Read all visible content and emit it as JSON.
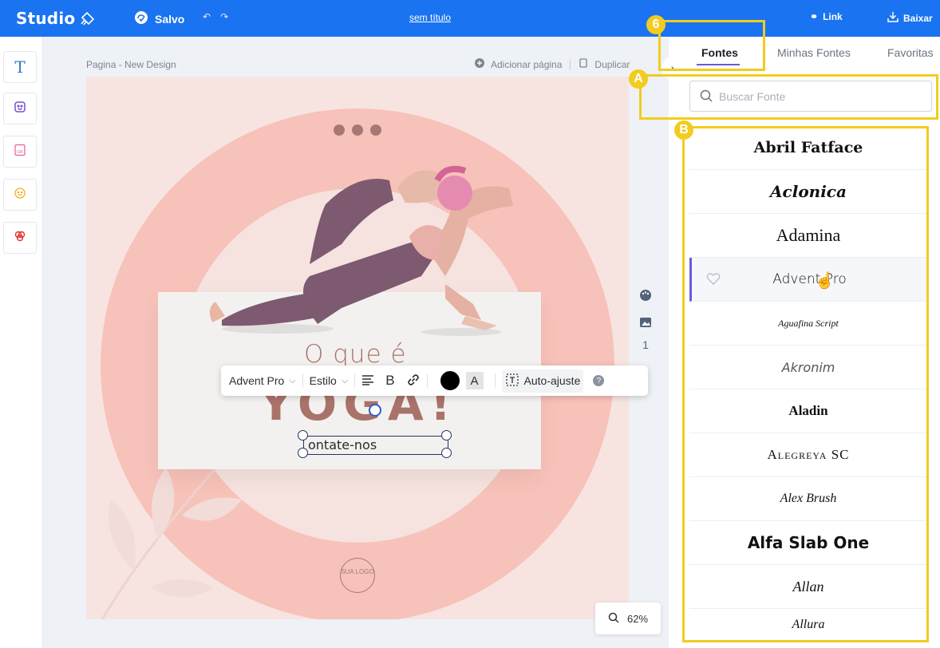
{
  "header": {
    "app_name": "Studio",
    "saved_label": "Salvo",
    "document_title": "sem título",
    "link_label": "Link",
    "download_label": "Baixar"
  },
  "left_tools": [
    {
      "name": "text-tool",
      "icon": "text-T-icon"
    },
    {
      "name": "sticker-tool",
      "icon": "sticker-icon"
    },
    {
      "name": "gif-tool",
      "icon": "gif-icon"
    },
    {
      "name": "emoji-tool",
      "icon": "smiley-icon"
    },
    {
      "name": "shapes-tool",
      "icon": "shapes-icon"
    }
  ],
  "canvas_header": {
    "page_label": "Pagina - New Design",
    "add_page": "Adicionar página",
    "duplicate": "Duplicar"
  },
  "design": {
    "headline_small": "O que é",
    "headline_big": "YOGA!",
    "contact_text": "ontate-nos",
    "logo_text": "SUA LOGO"
  },
  "text_toolbar": {
    "font": "Advent Pro",
    "style": "Estilo",
    "bold": "B",
    "text_color_label": "A",
    "auto_fit": "Auto-ajuste",
    "help": "?"
  },
  "side_controls": {
    "page_number": "1"
  },
  "zoom": {
    "value": "62%"
  },
  "font_panel": {
    "tabs": [
      "Fontes",
      "Minhas Fontes",
      "Favoritas"
    ],
    "active_tab": "Fontes",
    "search_placeholder": "Buscar Fonte",
    "fonts": [
      "Abril Fatface",
      "Aclonica",
      "Adamina",
      "Advent Pro",
      "Aguafina Script",
      "Akronim",
      "Aladin",
      "Alegreya SC",
      "Alex Brush",
      "Alfa Slab One",
      "Allan",
      "Allura"
    ],
    "selected_font": "Advent Pro"
  },
  "annotations": {
    "badge_tab": "6",
    "badge_search": "A",
    "badge_list": "B",
    "highlight_color": "#f2cc1f"
  },
  "colors": {
    "primary": "#1a73f0",
    "accent": "#6a5bd8",
    "canvas_bg": "#f7e4e1",
    "ring": "#f7c2b9",
    "headline": "#a9736a"
  }
}
